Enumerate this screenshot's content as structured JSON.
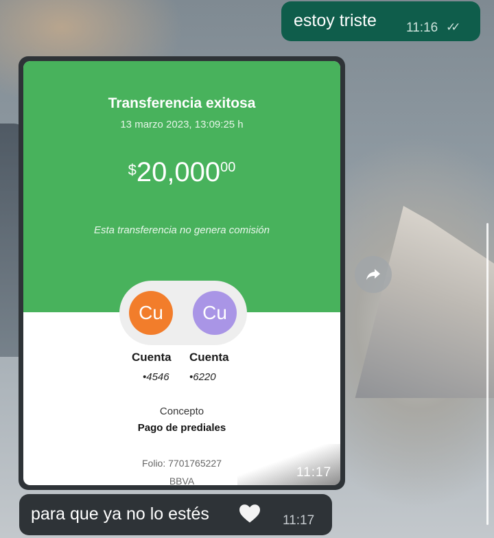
{
  "outgoing_message": {
    "text": "estoy triste",
    "time": "11:16",
    "status": "read"
  },
  "image_message": {
    "time": "11:17",
    "receipt": {
      "title": "Transferencia exitosa",
      "date": "13 marzo 2023, 13:09:25 h",
      "currency_symbol": "$",
      "amount_main": "20,000",
      "amount_cents": "00",
      "note": "Esta transferencia no genera comisión",
      "from_avatar": "Cu",
      "to_avatar": "Cu",
      "from_label": "Cuenta",
      "to_label": "Cuenta",
      "from_number": "•4546",
      "to_number": "•6220",
      "concept_label": "Concepto",
      "concept_value": "Pago de prediales",
      "folio": "Folio: 7701765227",
      "bank": "BBVA"
    },
    "colors": {
      "header_green": "#48b25c",
      "avatar_orange": "#f27d2b",
      "avatar_purple": "#a995e6"
    }
  },
  "incoming_message": {
    "text": "para que ya no lo estés",
    "emoji": "white-heart",
    "time": "11:17"
  },
  "icons": {
    "forward": "forward-arrow-icon",
    "read_receipt": "double-check-icon"
  },
  "colors": {
    "outgoing_bubble": "#0f5d4b",
    "incoming_bubble": "#2e3337"
  }
}
